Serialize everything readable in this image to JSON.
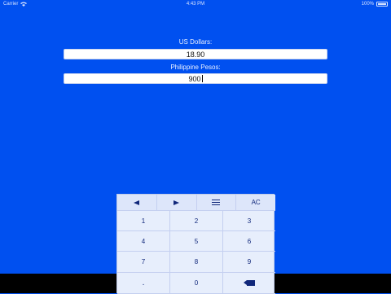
{
  "status_bar": {
    "carrier": "Carrier",
    "time": "4:43 PM",
    "battery": "100%"
  },
  "converter": {
    "usd_label": "US Dollars:",
    "usd_value": "18.90",
    "php_label": "Philippine Pesos:",
    "php_value": "900"
  },
  "keypad": {
    "top_row": {
      "left_icon": "left-arrow-icon",
      "right_icon": "right-arrow-icon",
      "menu_icon": "menu-icon",
      "clear_label": "AC"
    },
    "digits": [
      "1",
      "2",
      "3",
      "4",
      "5",
      "6",
      "7",
      "8",
      "9"
    ],
    "decimal": ".",
    "zero": "0",
    "backspace_icon": "backspace-icon"
  },
  "colors": {
    "background": "#0050f0",
    "keypad": "#e7eefc",
    "key_text": "#10277a"
  }
}
